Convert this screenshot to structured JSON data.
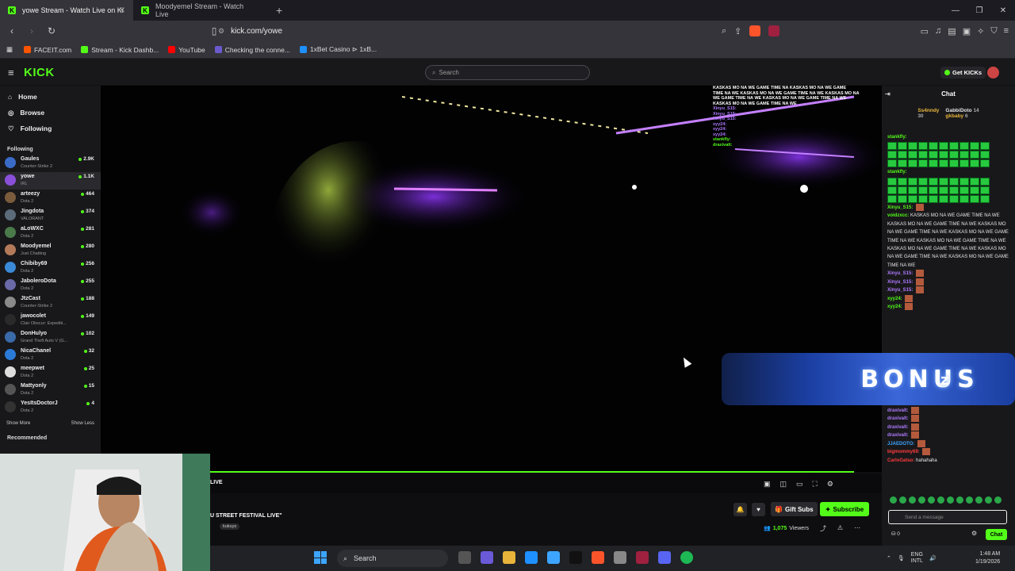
{
  "browser": {
    "tabs": [
      {
        "title": "yowe Stream - Watch Live on Ki",
        "active": true
      },
      {
        "title": "Moodyemel Stream - Watch Live",
        "active": false
      }
    ],
    "url": "kick.com/yowe",
    "bookmarks": [
      {
        "label": "FACEIT.com",
        "color": "#ff5500"
      },
      {
        "label": "Stream - Kick Dashb...",
        "color": "#53fc18"
      },
      {
        "label": "YouTube",
        "color": "#ff0000"
      },
      {
        "label": "Checking the conne...",
        "color": "#6a5acd"
      },
      {
        "label": "1xBet Casino ⊳ 1xB...",
        "color": "#1e90ff"
      }
    ]
  },
  "kick": {
    "logo": "KICK",
    "search_placeholder": "Search",
    "get_kicks": "Get KICKs",
    "nav": [
      {
        "label": "Home",
        "icon": "home-icon"
      },
      {
        "label": "Browse",
        "icon": "compass-icon"
      },
      {
        "label": "Following",
        "icon": "heart-icon"
      }
    ],
    "following_label": "Following",
    "following": [
      {
        "name": "Gaules",
        "game": "Counter-Strike 2",
        "viewers": "2.9K",
        "color": "#3a6bc7",
        "selected": false
      },
      {
        "name": "yowe",
        "game": "IRL",
        "viewers": "1.1K",
        "color": "#8a4fd8",
        "selected": true
      },
      {
        "name": "arteezy",
        "game": "Dota 2",
        "viewers": "464",
        "color": "#7a5c3c",
        "selected": false
      },
      {
        "name": "Jingdota",
        "game": "VALORANT",
        "viewers": "374",
        "color": "#5b6b7a",
        "selected": false
      },
      {
        "name": "aLoWXC",
        "game": "Dota 2",
        "viewers": "281",
        "color": "#4a7a4a",
        "selected": false
      },
      {
        "name": "Moodyemel",
        "game": "Just Chatting",
        "viewers": "280",
        "color": "#b37a5a",
        "selected": false
      },
      {
        "name": "Chibiby69",
        "game": "Dota 2",
        "viewers": "256",
        "color": "#3a8ad8",
        "selected": false
      },
      {
        "name": "JaboleroDota",
        "game": "Dota 2",
        "viewers": "255",
        "color": "#6a6aa8",
        "selected": false
      },
      {
        "name": "JtzCast",
        "game": "Counter-Strike 2",
        "viewers": "188",
        "color": "#8a8a8a",
        "selected": false
      },
      {
        "name": "jawocolet",
        "game": "Clair Obscur: Expediti...",
        "viewers": "149",
        "color": "#2a2a2a",
        "selected": false
      },
      {
        "name": "DonHulyo",
        "game": "Grand Theft Auto V (G...",
        "viewers": "102",
        "color": "#3a6aa8",
        "selected": false
      },
      {
        "name": "NicaChanel",
        "game": "Dota 2",
        "viewers": "32",
        "color": "#2a7ad8",
        "selected": false
      },
      {
        "name": "meepwet",
        "game": "Dota 2",
        "viewers": "25",
        "color": "#dddddd",
        "selected": false
      },
      {
        "name": "Mattyonly",
        "game": "Dota 2",
        "viewers": "15",
        "color": "#555555",
        "selected": false
      },
      {
        "name": "YesItsDoctorJ",
        "game": "Dota 2",
        "viewers": "4",
        "color": "#333333",
        "selected": false
      }
    ],
    "show_more": "Show More",
    "show_less": "Show Less",
    "recommended_label": "Recommended"
  },
  "player": {
    "live_label": "LIVE",
    "stream_title": "U STREET FESTIVAL LIVE\"",
    "tag": "kukuys",
    "overlay_chat": [
      "KASKAS MO NA WE GAME TIME NA KASKAS MO NA WE GAME",
      "TIME NA WE KASKAS MO NA WE GAME TIME NA WE KASKAS MO NA",
      "WE GAME TIME NA WE KASKAS MO NA WE GAME TIME NA WE",
      "KASKAS MO NA WE GAME TIME NA WE",
      "Xinyu_S15:",
      "Xinyu_S15:",
      "Xinyu_S15:",
      "xyy24:",
      "xyy24:",
      "xyy24:",
      "stankfly:",
      "draxivalt:"
    ]
  },
  "below": {
    "gift_subs": "Gift Subs",
    "subscribe": "Subscribe",
    "viewers_count": "1,075",
    "viewers_label": "Viewers"
  },
  "chat": {
    "title": "Chat",
    "leaders": [
      {
        "name": "Ss4nndy",
        "count": "30",
        "color": "#e8b53a"
      },
      {
        "name": "GabbiDoto",
        "count": "14",
        "color": "#ffffff"
      },
      {
        "name": "gkbaby",
        "count": "6",
        "color": "#e8b53a"
      }
    ],
    "messages": [
      {
        "user": "stankfly:",
        "color": "#53fc18",
        "text": "",
        "emotes": true
      },
      {
        "user": "stankfly:",
        "color": "#53fc18",
        "text": "",
        "emotes": true
      },
      {
        "user": "Xinyu_S15:",
        "color": "#53fc18",
        "text": "",
        "emotes": false
      },
      {
        "user": "voidzxcc:",
        "color": "#53fc18",
        "text": "KASKAS MO NA WE GAME TIME NA WE KASKAS MO NA WE GAME TIME NA WE KASKAS MO NA WE GAME TIME NA WE KASKAS MO NA WE GAME TIME NA WE KASKAS MO NA WE GAME TIME NA WE KASKAS MO NA WE GAME TIME NA WE KASKAS MO NA WE GAME TIME NA WE KASKAS MO NA WE GAME TIME NA WE",
        "emotes": false
      },
      {
        "user": "Xinyu_S15:",
        "color": "#b07aff",
        "text": "",
        "emotes": false
      },
      {
        "user": "Xinyu_S15:",
        "color": "#b07aff",
        "text": "",
        "emotes": false
      },
      {
        "user": "Xinyu_S15:",
        "color": "#b07aff",
        "text": "",
        "emotes": false
      },
      {
        "user": "xyy24:",
        "color": "#53fc18",
        "text": "",
        "emotes": false
      },
      {
        "user": "xyy24:",
        "color": "#53fc18",
        "text": "",
        "emotes": false
      }
    ],
    "messages_bottom": [
      {
        "user": "draxivalt:",
        "color": "#b07aff",
        "text": ""
      },
      {
        "user": "draxivalt:",
        "color": "#b07aff",
        "text": ""
      },
      {
        "user": "draxivalt:",
        "color": "#b07aff",
        "text": ""
      },
      {
        "user": "draxivalt:",
        "color": "#b07aff",
        "text": ""
      },
      {
        "user": "JJAEDOTO:",
        "color": "#3da5ff",
        "text": ""
      },
      {
        "user": "bigmommy69:",
        "color": "#ff3b3b",
        "text": ""
      },
      {
        "user": "CarloGatso:",
        "color": "#ff3b3b",
        "text": "hahahaha"
      }
    ],
    "input_placeholder": "Send a message",
    "send_label": "Chat",
    "points": "0"
  },
  "overlay": {
    "bonus_text": "BONUS",
    "bonus_prefix": "z"
  },
  "taskbar": {
    "search": "Search",
    "lang1": "ENG",
    "lang2": "INTL",
    "time": "1:48 AM",
    "date": "1/19/2026"
  }
}
